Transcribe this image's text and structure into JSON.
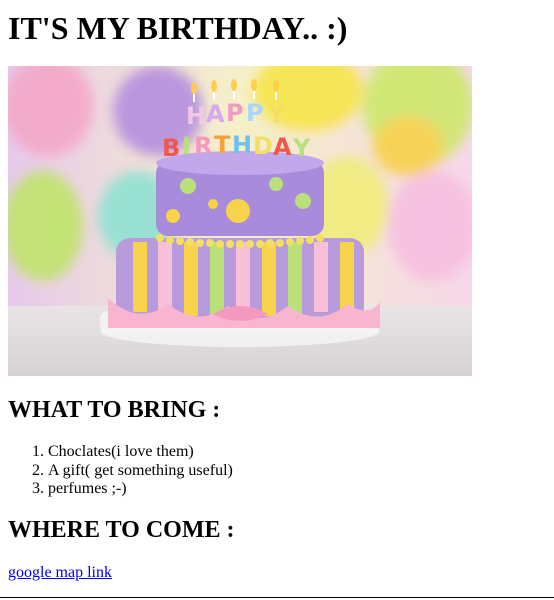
{
  "title": "IT'S MY BIRTHDAY.. :)",
  "image": {
    "icon": "birthday-cake-photo",
    "text": "HAPPY BIRTHDAY"
  },
  "bring": {
    "heading": "WHAT TO BRING :",
    "items": [
      "Choclates(i love them)",
      "A gift( get something useful)",
      "perfumes ;-)"
    ]
  },
  "come": {
    "heading": "WHERE TO COME :",
    "link_label": "google map link"
  }
}
